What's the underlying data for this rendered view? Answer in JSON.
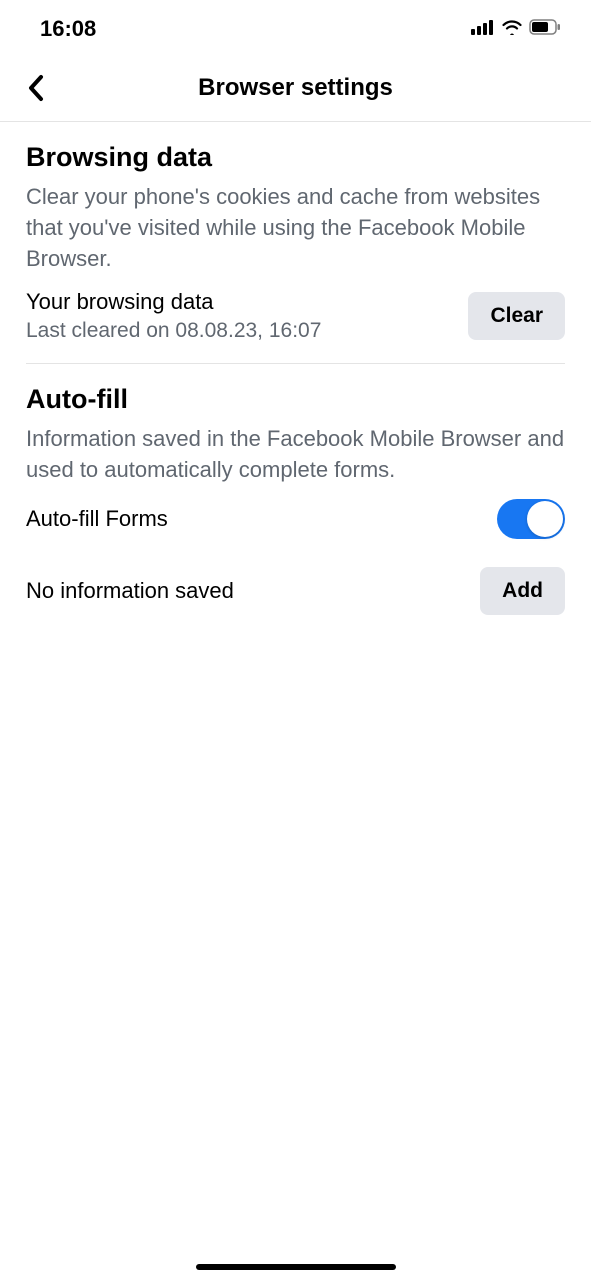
{
  "status": {
    "time": "16:08"
  },
  "header": {
    "title": "Browser settings"
  },
  "sections": {
    "browsing": {
      "title": "Browsing data",
      "description": "Clear your phone's cookies and cache from websites that you've visited while using the Facebook Mobile Browser.",
      "row_title": "Your browsing data",
      "row_sub": "Last cleared on 08.08.23, 16:07",
      "clear_label": "Clear"
    },
    "autofill": {
      "title": "Auto-fill",
      "description": "Information saved in the Facebook Mobile Browser and used to automatically complete forms.",
      "toggle_label": "Auto-fill Forms",
      "toggle_on": true,
      "info_label": "No information saved",
      "add_label": "Add"
    }
  }
}
